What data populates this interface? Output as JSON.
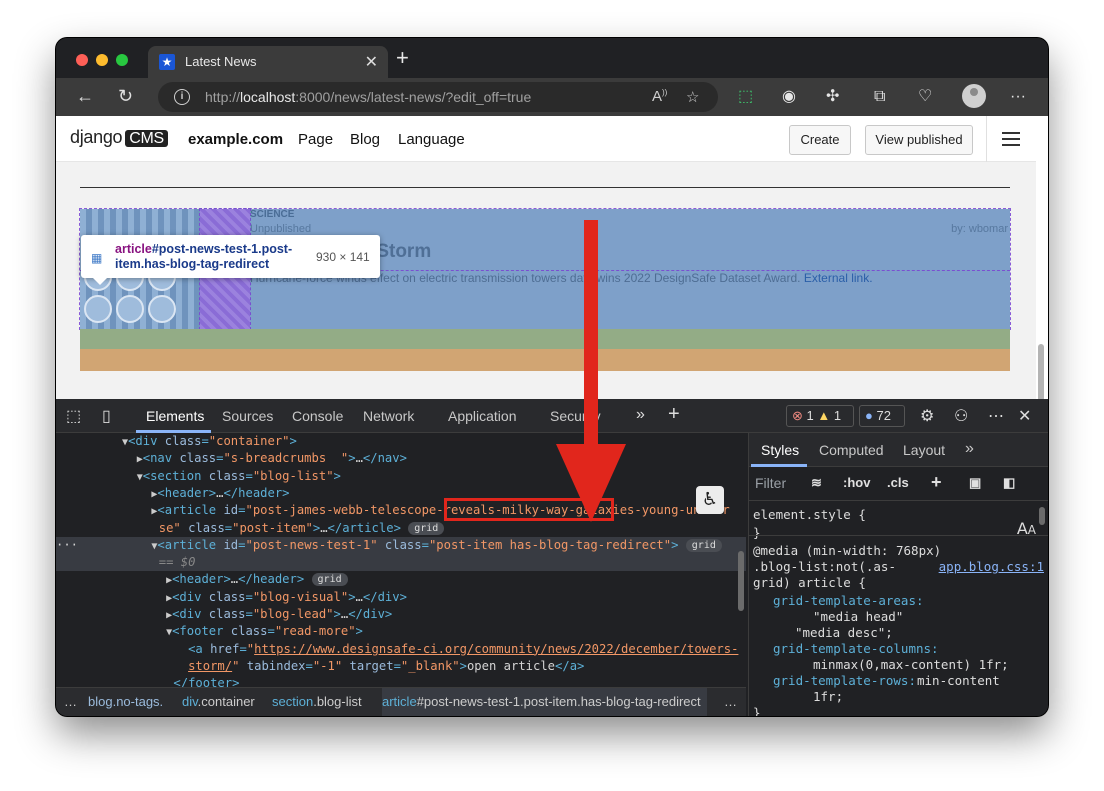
{
  "browser": {
    "tab_title": "Latest News",
    "url_prefix": "http://",
    "url_host": "localhost",
    "url_rest": ":8000/news/latest-news/?edit_off=true"
  },
  "cms": {
    "logo_text": "django",
    "logo_badge": "CMS",
    "site": "example.com",
    "menu": [
      "Page",
      "Blog",
      "Language"
    ],
    "create_label": "Create",
    "view_published_label": "View published"
  },
  "tooltip": {
    "tag": "article",
    "selector": "#post-news-test-1.post-item.has-blog-tag-redirect",
    "dimensions": "930 × 141"
  },
  "article": {
    "category": "SCIENCE",
    "status": "Unpublished",
    "byline": "by: wbomar",
    "title": "Towers in the Storm",
    "lead": "Hurricane-force winds effect on electric transmission towers data wins 2022 DesignSafe Dataset Award.",
    "lead_link": "External link."
  },
  "devtools": {
    "tabs": [
      "Elements",
      "Sources",
      "Console",
      "Network",
      "Application",
      "Security"
    ],
    "active_tab": "Elements",
    "errors": "1",
    "warnings": "1",
    "messages": "72",
    "styles_tabs": [
      "Styles",
      "Computed",
      "Layout"
    ],
    "filter_placeholder": "Filter",
    "hov": ":hov",
    "cls": ".cls",
    "breadcrumbs": [
      {
        "tag": "",
        "cls": "blog.no-tags."
      },
      {
        "tag": "div",
        "cls": ".container"
      },
      {
        "tag": "section",
        "cls": ".blog-list"
      },
      {
        "tag": "article",
        "cls": "#post-news-test-1.post-item.has-blog-tag-redirect"
      }
    ],
    "styles": {
      "element_style": "element.style {",
      "close": "}",
      "media": "@media (min-width: 768px)",
      "selector1": ".blog-list:not(.as-",
      "selector2": "grid) article {",
      "source": "app.blog.css:1",
      "p1": "grid-template-areas:",
      "v1a": "\"media head\"",
      "v1b": "\"media desc\";",
      "p2": "grid-template-columns:",
      "v2": "minmax(0,max-content) 1fr;",
      "p3": "grid-template-rows:",
      "v3": "min-content",
      "v3b": "1fr;"
    }
  }
}
